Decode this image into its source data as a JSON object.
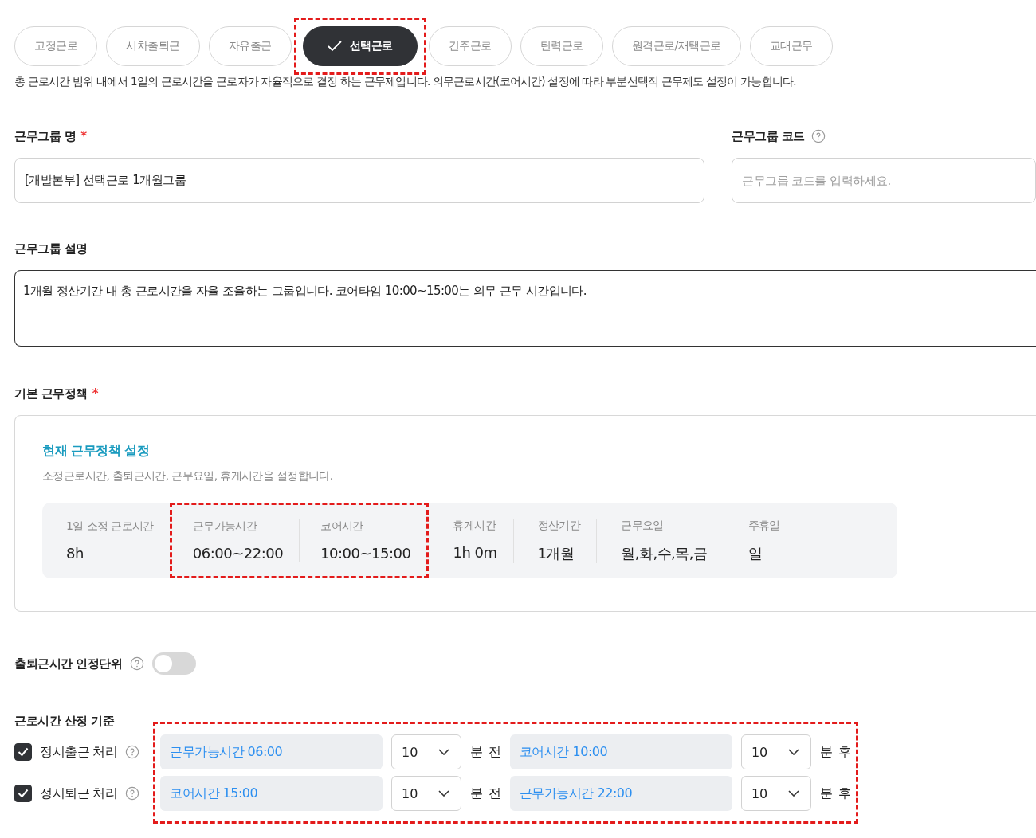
{
  "tabs": [
    {
      "label": "고정근로",
      "selected": false,
      "highlighted": false
    },
    {
      "label": "시차출퇴근",
      "selected": false,
      "highlighted": false
    },
    {
      "label": "자유출근",
      "selected": false,
      "highlighted": false
    },
    {
      "label": "선택근로",
      "selected": true,
      "highlighted": true
    },
    {
      "label": "간주근로",
      "selected": false,
      "highlighted": false
    },
    {
      "label": "탄력근로",
      "selected": false,
      "highlighted": false
    },
    {
      "label": "원격근로/재택근로",
      "selected": false,
      "highlighted": false
    },
    {
      "label": "교대근무",
      "selected": false,
      "highlighted": false
    }
  ],
  "tab_description": "총 근로시간 범위 내에서 1일의 근로시간을 근로자가 자율적으로 결정 하는 근무제입니다. 의무근로시간(코어시간) 설정에 따라 부분선택적 근무제도 설정이 가능합니다.",
  "group_name": {
    "label": "근무그룹 명",
    "required_mark": "*",
    "value": "[개발본부] 선택근로 1개월그룹"
  },
  "group_code": {
    "label": "근무그룹 코드",
    "placeholder": "근무그룹 코드를 입력하세요."
  },
  "group_description": {
    "label": "근무그룹 설명",
    "value": "1개월 정산기간 내 총 근로시간을 자율 조율하는 그룹입니다. 코어타임 10:00~15:00는 의무 근무 시간입니다."
  },
  "policy": {
    "label": "기본 근무정책",
    "required_mark": "*",
    "title": "현재 근무정책 설정",
    "subtitle": "소정근로시간, 출퇴근시간, 근무요일, 휴게시간을 설정합니다.",
    "groups": [
      {
        "highlighted": false,
        "items": [
          {
            "label": "1일 소정 근로시간",
            "value": "8h"
          }
        ]
      },
      {
        "highlighted": true,
        "items": [
          {
            "label": "근무가능시간",
            "value": "06:00~22:00"
          },
          {
            "label": "코어시간",
            "value": "10:00~15:00"
          }
        ]
      },
      {
        "highlighted": false,
        "items": [
          {
            "label": "휴게시간",
            "value": "1h 0m"
          },
          {
            "label": "정산기간",
            "value": "1개월"
          },
          {
            "label": "근무요일",
            "value": "월,화,수,목,금"
          },
          {
            "label": "주휴일",
            "value": "일"
          }
        ]
      }
    ]
  },
  "recognition_unit": {
    "label": "출퇴근시간 인정단위",
    "on": false
  },
  "calc_basis": {
    "label": "근로시간 산정 기준",
    "highlighted": true,
    "rows": [
      {
        "label": "정시출근 처리",
        "checked": true,
        "from": "근무가능시간 06:00",
        "from_minutes": "10",
        "from_suffix": "분 전",
        "to": "코어시간 10:00",
        "to_minutes": "10",
        "to_suffix": "분 후"
      },
      {
        "label": "정시퇴근 처리",
        "checked": true,
        "from": "코어시간 15:00",
        "from_minutes": "10",
        "from_suffix": "분 전",
        "to": "근무가능시간 22:00",
        "to_minutes": "10",
        "to_suffix": "분 후"
      }
    ]
  }
}
